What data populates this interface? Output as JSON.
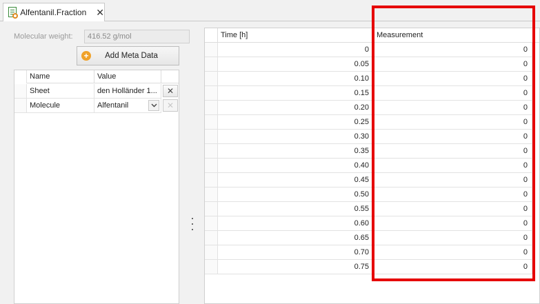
{
  "tab": {
    "title": "Alfentanil.Fraction",
    "icon": "spreadsheet-file-icon",
    "close_glyph": "✕"
  },
  "molecular_weight": {
    "label": "Molecular weight:",
    "value": "416.52 g/mol"
  },
  "meta_button": {
    "label": "Add Meta Data",
    "icon": "plus-circle-icon",
    "color": "#f0a22a"
  },
  "meta_grid": {
    "columns": [
      "Name",
      "Value"
    ],
    "rows": [
      {
        "name": "Sheet",
        "value": "den Holländer 1...",
        "delete_glyph": "✕",
        "delete_enabled": true
      },
      {
        "name": "Molecule",
        "value": "Alfentanil",
        "delete_glyph": "✕",
        "delete_enabled": false
      }
    ]
  },
  "data_grid": {
    "columns": [
      "Time [h]",
      "Measurement"
    ],
    "rows": [
      [
        "0",
        "0"
      ],
      [
        "0.05",
        "0"
      ],
      [
        "0.10",
        "0"
      ],
      [
        "0.15",
        "0"
      ],
      [
        "0.20",
        "0"
      ],
      [
        "0.25",
        "0"
      ],
      [
        "0.30",
        "0"
      ],
      [
        "0.35",
        "0"
      ],
      [
        "0.40",
        "0"
      ],
      [
        "0.45",
        "0"
      ],
      [
        "0.50",
        "0"
      ],
      [
        "0.55",
        "0"
      ],
      [
        "0.60",
        "0"
      ],
      [
        "0.65",
        "0"
      ],
      [
        "0.70",
        "0"
      ],
      [
        "0.75",
        "0"
      ]
    ]
  },
  "highlight_color": "#e60000"
}
